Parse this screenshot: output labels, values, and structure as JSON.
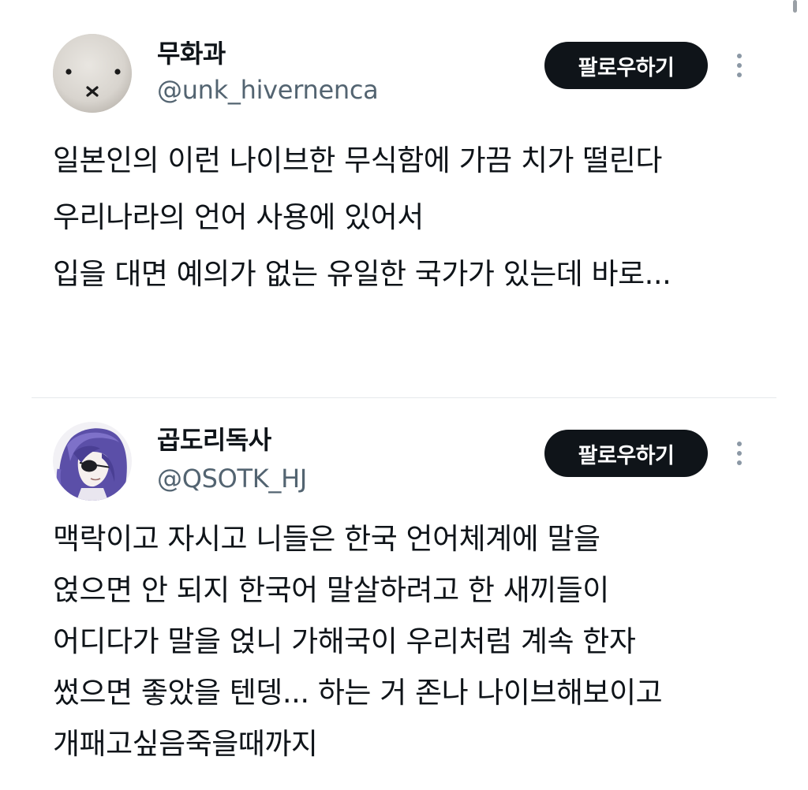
{
  "tweets": [
    {
      "display_name": "무화과",
      "handle": "@unk_hivernenca",
      "follow_label": "팔로우하기",
      "avatar_icon": "miffy-face-avatar",
      "text_lines": [
        "일본인의 이런 나이브한 무식함에 가끔 치가 떨린다",
        "우리나라의 언어 사용에 있어서",
        "입을 대면 예의가 없는 유일한 국가가 있는데 바로..."
      ]
    },
    {
      "display_name": "곱도리독사",
      "handle": "@QSOTK_HJ",
      "follow_label": "팔로우하기",
      "avatar_icon": "anime-character-avatar",
      "text_lines": [
        "맥락이고 자시고 니들은 한국 언어체계에 말을",
        "얹으면 안 되지 한국어 말살하려고 한 새끼들이",
        "어디다가 말을 얹니 가해국이 우리처럼 계속 한자",
        "썼으면 좋았을 텐뎅... 하는 거 존나 나이브해보이고",
        "개패고싶음죽을때까지"
      ]
    }
  ],
  "colors": {
    "text": "#0f1419",
    "handle": "#536471",
    "button_bg": "#0f1419",
    "button_text": "#ffffff",
    "divider": "#e6e9ec"
  }
}
